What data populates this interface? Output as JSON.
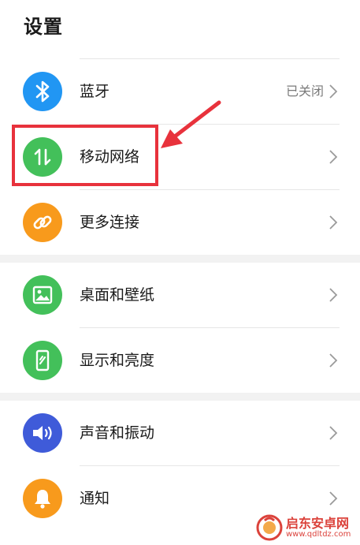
{
  "page": {
    "title": "设置"
  },
  "groups": [
    {
      "items": [
        {
          "label": "蓝牙",
          "value": "已关闭",
          "icon": "bluetooth-icon",
          "color": "#2196f3"
        },
        {
          "label": "移动网络",
          "value": "",
          "icon": "mobile-data-icon",
          "color": "#43c05a"
        },
        {
          "label": "更多连接",
          "value": "",
          "icon": "link-icon",
          "color": "#f89a1c"
        }
      ]
    },
    {
      "items": [
        {
          "label": "桌面和壁纸",
          "value": "",
          "icon": "wallpaper-icon",
          "color": "#43c05a"
        },
        {
          "label": "显示和亮度",
          "value": "",
          "icon": "display-brightness-icon",
          "color": "#43c05a"
        }
      ]
    },
    {
      "items": [
        {
          "label": "声音和振动",
          "value": "",
          "icon": "speaker-icon",
          "color": "#3f5bd9"
        },
        {
          "label": "通知",
          "value": "",
          "icon": "bell-icon",
          "color": "#f89a1c"
        }
      ]
    }
  ],
  "watermark": {
    "main": "启东安卓网",
    "sub": "www.qdltdz.com"
  },
  "colors": {
    "highlight": "#e8323c",
    "divider": "#e6e6e6",
    "section_gap": "#f2f2f2"
  }
}
